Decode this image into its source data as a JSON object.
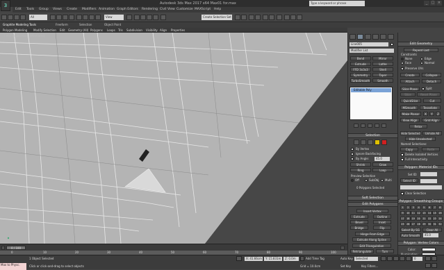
{
  "window": {
    "title": "Autodesk 3ds Max 2017 x64   Max01 for.max",
    "search_placeholder": "Type a keyword or phrase",
    "logo": "3",
    "controls": [
      "_",
      "□",
      "×"
    ]
  },
  "menu": [
    "Edit",
    "Tools",
    "Group",
    "Views",
    "Create",
    "Modifiers",
    "Animation",
    "Graph Editors",
    "Rendering",
    "Civil View",
    "Customize",
    "MAXScript",
    "Help"
  ],
  "toolbar": {
    "filter": "All",
    "ref_coord": "View",
    "selection_set": "Create Selection Set"
  },
  "ribbon": {
    "tabs": [
      "Graphite Modeling Tools",
      "Freeform",
      "Selection",
      "Object Paint"
    ],
    "sub_tabs": [
      "Polygon Modeling",
      "Modify Selection",
      "Edit",
      "Geometry (All)",
      "Polygons",
      "Loops",
      "Tris",
      "Subdivision",
      "Visibility",
      "Align",
      "Properties"
    ]
  },
  "viewport": {
    "label": "[+] [Perspective] [Wireframe]"
  },
  "command_panel": {
    "object_name": "Line005",
    "modifier_list": "Modifier List",
    "modifier_buttons": [
      "Bend",
      "Mirror",
      "Extrude",
      "Lathe",
      "FFD 3x3x3",
      "Shell",
      "Symmetry",
      "Taper",
      "TurboSmooth",
      "Smooth"
    ],
    "stack_item": "Editable Poly",
    "selection": {
      "header": "Selection",
      "by_vertex": "By Vertex",
      "ignore_backfacing": "Ignore Backfacing",
      "by_angle": "By Angle:",
      "by_angle_value": "45.0",
      "shrink": "Shrink",
      "grow": "Grow",
      "ring": "Ring",
      "loop": "Loop",
      "preview_selection": "Preview Selection",
      "preview_options": [
        "Off",
        "SubObj",
        "Multi"
      ],
      "status": "0 Polygons Selected"
    },
    "soft_selection": "Soft Selection",
    "edit_polygons": {
      "header": "Edit Polygons",
      "insert_vertex": "Insert Vertex",
      "buttons": [
        "Extrude",
        "Outline",
        "Bevel",
        "Inset",
        "Bridge",
        "Flip"
      ],
      "hinge": "Hinge From Edge",
      "extrude_spline": "Extrude Along Spline",
      "edit_triangulation": "Edit Triangulation",
      "retriangulate": "Retriangulate",
      "turn": "Turn"
    }
  },
  "edit_geometry": {
    "header": "Edit Geometry",
    "repeat_last": "Repeat Last",
    "constraints": "Constraints",
    "constraint_options": [
      "None",
      "Edge",
      "Face",
      "Normal"
    ],
    "preserve_uvs": "Preserve UVs",
    "buttons": [
      "Create",
      "Collapse",
      "Attach",
      "Detach"
    ],
    "slice_plane": "Slice Plane",
    "split": "Split",
    "slice": "Slice",
    "reset_plane": "Reset Plane",
    "quickslice": "QuickSlice",
    "cut": "Cut",
    "msmooth": "MSmooth",
    "tessellate": "Tessellate",
    "make_planar": "Make Planar",
    "xyz": [
      "X",
      "Y",
      "Z"
    ],
    "view_align": "View Align",
    "grid_align": "Grid Align",
    "relax": "Relax",
    "hide_selected": "Hide Selected",
    "unhide_all": "Unhide All",
    "hide_unselected": "Hide Unselected",
    "named_selections": "Named Selections:",
    "copy": "Copy",
    "paste": "Paste",
    "delete_isolated": "Delete Isolated Vertices",
    "full_interactivity": "Full Interactivity"
  },
  "material_ids": {
    "header": "Polygon: Material IDs",
    "set_id": "Set ID:",
    "select_id": "Select ID",
    "clear_selection": "Clear Selection"
  },
  "smoothing_groups": {
    "header": "Polygon: Smoothing Groups",
    "numbers": [
      "1",
      "2",
      "3",
      "4",
      "5",
      "6",
      "7",
      "8",
      "9",
      "10",
      "11",
      "12",
      "13",
      "14",
      "15",
      "16",
      "17",
      "18",
      "19",
      "20",
      "21",
      "22",
      "23",
      "24",
      "25",
      "26",
      "27",
      "28",
      "29",
      "30",
      "31",
      "32"
    ],
    "select_by_sg": "Select By SG",
    "clear_all": "Clear All",
    "auto_smooth": "Auto Smooth",
    "auto_smooth_value": "45.0"
  },
  "vertex_colors": {
    "header": "Polygon: Vertex Colors",
    "color": "Color:",
    "illumination": "Illumination:",
    "alpha": "Alpha:",
    "alpha_value": "100.0"
  },
  "timeline": {
    "frame": "0 / 100",
    "ticks": [
      "0",
      "10",
      "20",
      "30",
      "40",
      "50",
      "60",
      "70",
      "80",
      "90",
      "100"
    ]
  },
  "status": {
    "maxscript": "Max to Physc.",
    "object_selected": "1 Object Selected",
    "prompt": "Click or click-and-drag to select objects",
    "x": "X: 41.66cm",
    "y": "Y: 15.831m",
    "z": "Z: 0.0m",
    "grid": "Grid = 10.0cm",
    "auto_key": "Auto Key",
    "selected": "Selected",
    "set_key": "Set Key",
    "key_filters": "Key Filters...",
    "add_time_tag": "Add Time Tag",
    "frame": "0"
  }
}
